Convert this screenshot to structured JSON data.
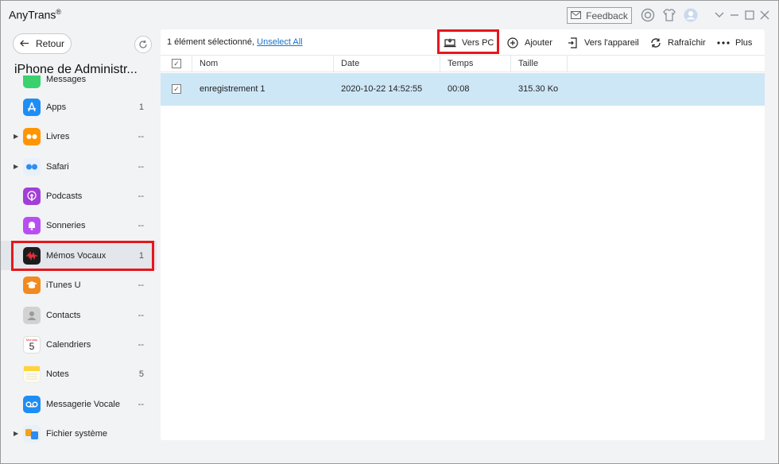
{
  "app": {
    "title": "AnyTrans",
    "trademark": "®"
  },
  "titlebar": {
    "feedback_label": "Feedback"
  },
  "sidebar": {
    "back_label": "Retour",
    "device_name": "iPhone de Administr...",
    "items": [
      {
        "label": "Messages",
        "count": "",
        "icon": "messages-icon",
        "color": "#3bd16f"
      },
      {
        "label": "Apps",
        "count": "1",
        "icon": "app-store-icon",
        "color": "#1e8ef5"
      },
      {
        "label": "Livres",
        "count": "--",
        "icon": "books-icon",
        "color": "#ff9500"
      },
      {
        "label": "Safari",
        "count": "--",
        "icon": "safari-icon",
        "color": "#2f8cf0"
      },
      {
        "label": "Podcasts",
        "count": "--",
        "icon": "podcasts-icon",
        "color": "#a23fd6"
      },
      {
        "label": "Sonneries",
        "count": "--",
        "icon": "bell-icon",
        "color": "#b84ef2"
      },
      {
        "label": "Mémos Vocaux",
        "count": "1",
        "icon": "voice-memo-icon",
        "color": "#1c1c1e"
      },
      {
        "label": "iTunes U",
        "count": "--",
        "icon": "graduation-cap-icon",
        "color": "#f28a1e"
      },
      {
        "label": "Contacts",
        "count": "--",
        "icon": "contacts-icon",
        "color": "#c9c9c9"
      },
      {
        "label": "Calendriers",
        "count": "--",
        "icon": "calendar-icon",
        "color": "#ffffff"
      },
      {
        "label": "Notes",
        "count": "5",
        "icon": "notes-icon",
        "color": "#ffd33b"
      },
      {
        "label": "Messagerie Vocale",
        "count": "--",
        "icon": "voicemail-icon",
        "color": "#1e8ef5"
      },
      {
        "label": "Fichier système",
        "count": "",
        "icon": "file-system-icon",
        "color": "#2f8cf0"
      }
    ],
    "calendar_day": "5",
    "calendar_weekday": "Monday"
  },
  "toolbar": {
    "selection_text": "1 élément sélectionné,",
    "unselect_label": "Unselect All",
    "to_pc_label": "Vers PC",
    "add_label": "Ajouter",
    "to_device_label": "Vers l'appareil",
    "refresh_label": "Rafraîchir",
    "more_label": "Plus"
  },
  "table": {
    "columns": [
      "Nom",
      "Date",
      "Temps",
      "Taille"
    ],
    "rows": [
      {
        "name": "enregistrement 1",
        "date": "2020-10-22 14:52:55",
        "time": "00:08",
        "size": "315.30 Ko",
        "checked": true
      }
    ]
  },
  "colors": {
    "highlight": "#e5171c",
    "selected_row": "#cde7f7",
    "link": "#1a73c9"
  }
}
